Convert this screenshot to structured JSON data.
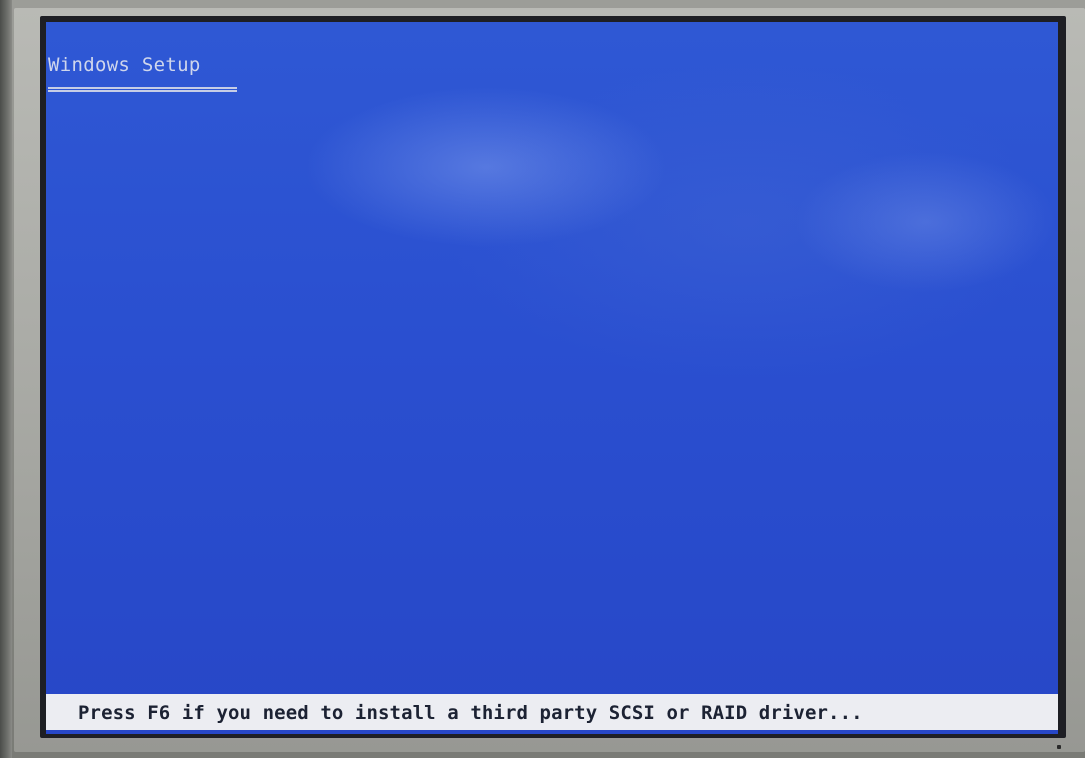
{
  "setup_screen": {
    "title": "Windows Setup",
    "status_message": "Press F6 if you need to install a third party SCSI or RAID driver..."
  },
  "colors": {
    "screen_background": "#2b50d0",
    "title_text": "#cfd6ec",
    "status_bar_background": "#ecedf2",
    "status_text": "#1c2233"
  }
}
